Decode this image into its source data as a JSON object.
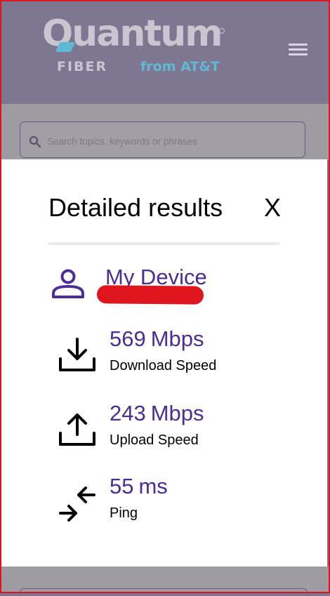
{
  "header": {
    "logo": {
      "wordmark": "Quantum",
      "sub": "FIBER",
      "from": "from AT&T"
    }
  },
  "search": {
    "placeholder": "Search topics, keywords or phrases"
  },
  "modal": {
    "title": "Detailed results",
    "close_label": "X",
    "device_label": "My Device",
    "metrics": [
      {
        "value": "569",
        "unit": "Mbps",
        "label": "Download Speed",
        "icon": "download-icon"
      },
      {
        "value": "243",
        "unit": "Mbps",
        "label": "Upload Speed",
        "icon": "upload-icon"
      },
      {
        "value": "55",
        "unit": "ms",
        "label": "Ping",
        "icon": "ping-arrows-icon"
      }
    ]
  },
  "colors": {
    "header_bg": "#7f7791",
    "overlay": "#9f9ba3",
    "accent": "#4b2d96",
    "logo_blue": "#5fb9d3",
    "annotation": "#e0141c"
  }
}
